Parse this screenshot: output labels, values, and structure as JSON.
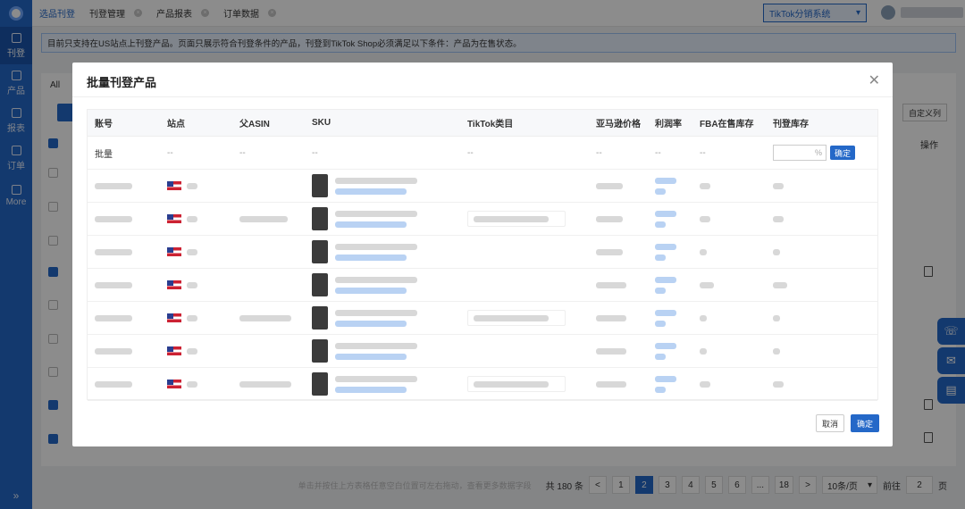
{
  "sidebar": {
    "items": [
      {
        "label": "刊登",
        "icon": "publish-icon"
      },
      {
        "label": "产品",
        "icon": "product-icon"
      },
      {
        "label": "报表",
        "icon": "report-icon"
      },
      {
        "label": "订单",
        "icon": "order-icon"
      },
      {
        "label": "More",
        "icon": "more-icon"
      }
    ],
    "collapse": "»"
  },
  "topbar": {
    "tabs": [
      {
        "label": "选品刊登"
      },
      {
        "label": "刊登管理"
      },
      {
        "label": "产品报表"
      },
      {
        "label": "订单数据"
      }
    ],
    "system_select": "TikTok分销系统"
  },
  "notice": "目前只支持在US站点上刊登产品。页面只展示符合刊登条件的产品，刊登到TikTok Shop必须满足以下条件：产品为在售状态。",
  "background": {
    "filter_label": "All",
    "right_button": "自定义列",
    "op_header": "操作"
  },
  "modal": {
    "title": "批量刊登产品",
    "columns": [
      "账号",
      "站点",
      "父ASIN",
      "SKU",
      "TikTok类目",
      "亚马逊价格",
      "利润率",
      "FBA在售库存",
      "刊登库存"
    ],
    "batch_row": {
      "account": "批量",
      "site": "--",
      "parent_asin": "--",
      "sku": "--",
      "category": "--",
      "price": "--",
      "margin": "--",
      "fba": "--",
      "pct_placeholder": "%",
      "confirm": "确定"
    },
    "cancel": "取消",
    "ok": "确定"
  },
  "pagination": {
    "hint": "单击并按住上方表格任意空白位置可左右拖动，查看更多数据字段",
    "total": "共 180 条",
    "prev": "<",
    "pages": [
      "1",
      "2",
      "3",
      "4",
      "5",
      "6",
      "...",
      "18"
    ],
    "current": "2",
    "next": ">",
    "page_size": "10条/页",
    "goto_label": "前往",
    "goto_value": "2",
    "page_unit": "页"
  }
}
